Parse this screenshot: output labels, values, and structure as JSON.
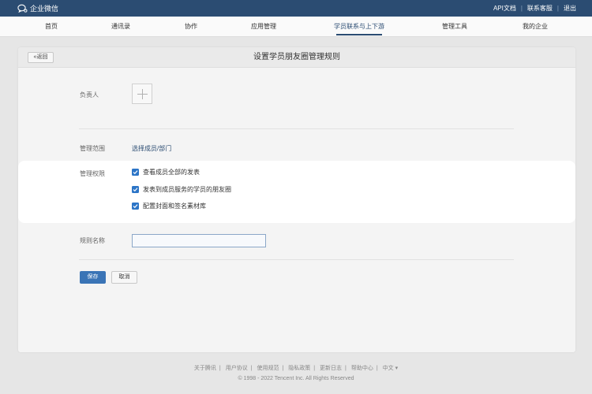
{
  "topbar": {
    "logo_text": "企业微信",
    "links": [
      "API文档",
      "联系客服",
      "退出"
    ]
  },
  "nav": {
    "items": [
      "首页",
      "通讯录",
      "协作",
      "应用管理",
      "学员联系与上下游",
      "管理工具",
      "我的企业"
    ],
    "active_index": 4
  },
  "card": {
    "back_label": "返回",
    "title": "设置学员朋友圈管理规则"
  },
  "form": {
    "owner_label": "负责人",
    "scope_label": "管理范围",
    "scope_link": "选择成员/部门",
    "permission_label": "管理权限",
    "permissions": [
      {
        "label": "查看成员全部的发表",
        "checked": true
      },
      {
        "label": "发表到成员服务的学员的朋友圈",
        "checked": true
      },
      {
        "label": "配置封面和签名素材库",
        "checked": true
      }
    ],
    "rule_name_label": "规则名称",
    "rule_name_value": "",
    "save_label": "保存",
    "cancel_label": "取消"
  },
  "footer": {
    "links": [
      "关于腾讯",
      "用户协议",
      "使用规范",
      "隐私政策",
      "更新日志",
      "帮助中心",
      "中文"
    ],
    "copyright": "© 1998 - 2022 Tencent Inc. All Rights Reserved"
  },
  "colors": {
    "brand": "#2b4c72",
    "primary_button": "#3a74b6",
    "checkbox": "#2c75c7"
  }
}
